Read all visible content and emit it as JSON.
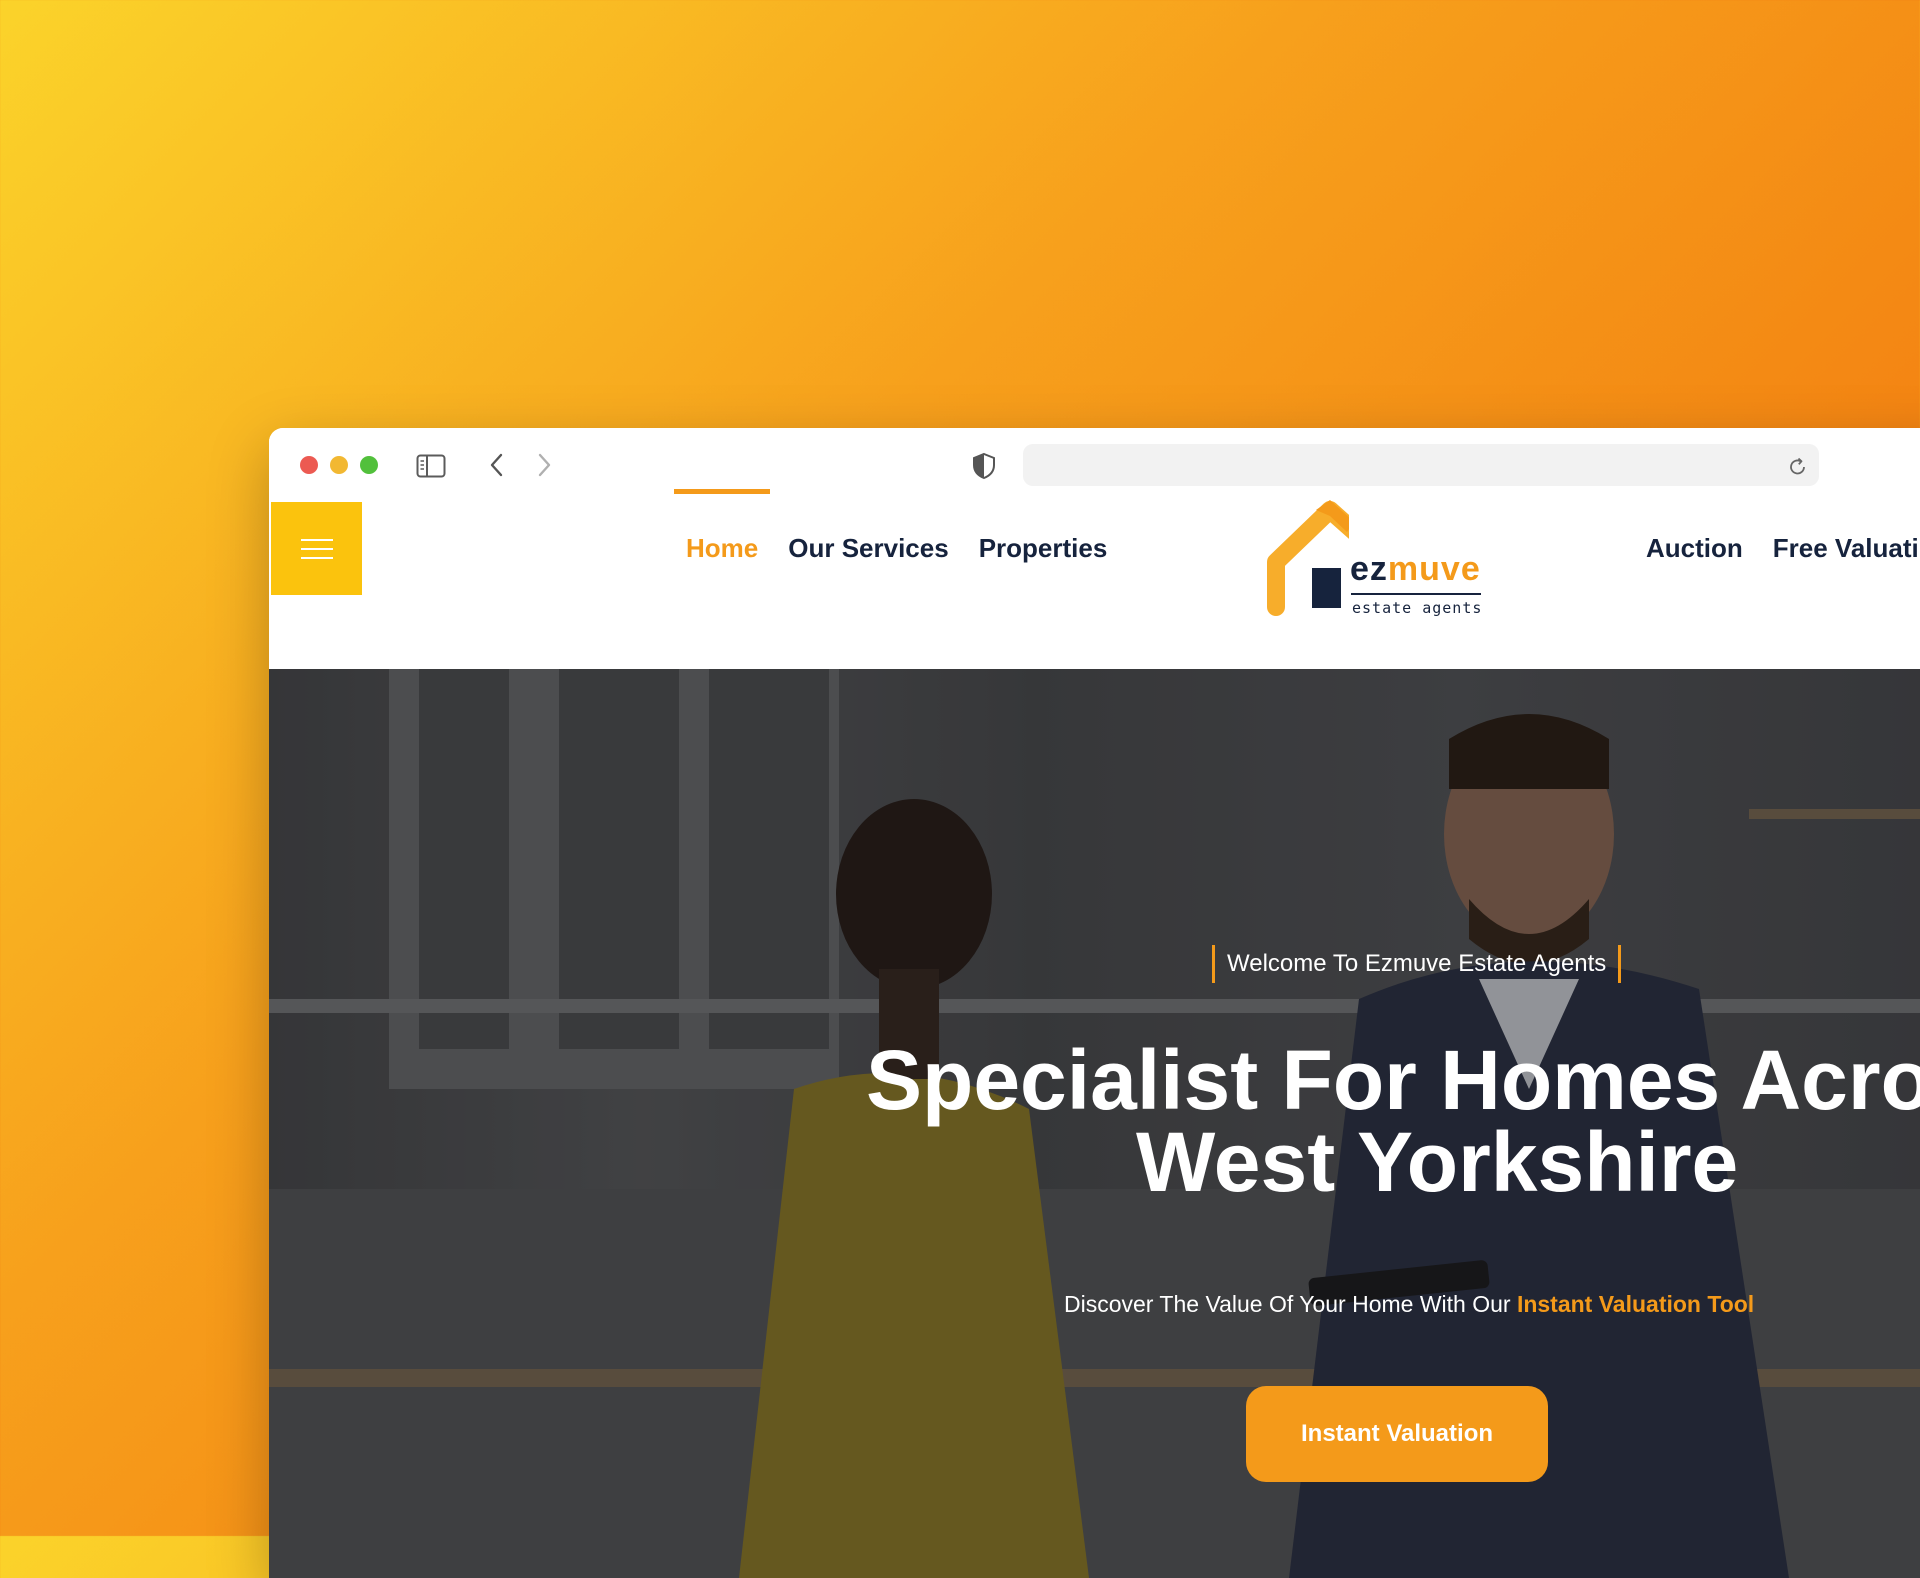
{
  "browser": {
    "address_value": ""
  },
  "header": {
    "nav_left": [
      {
        "label": "Home",
        "active": true
      },
      {
        "label": "Our Services"
      },
      {
        "label": "Properties"
      }
    ],
    "nav_right": [
      {
        "label": "Auction"
      },
      {
        "label": "Free Valuati"
      }
    ],
    "logo": {
      "brand_prefix": "ez",
      "brand_suffix": "muve",
      "tagline": "estate agents"
    }
  },
  "hero": {
    "kicker": "Welcome To Ezmuve Estate Agents",
    "headline_line1": "Specialist For Homes Across",
    "headline_line2": "West Yorkshire",
    "subtext_prefix": "Discover The Value Of Your Home With Our ",
    "subtext_highlight": "Instant Valuation Tool",
    "cta_label": "Instant Valuation"
  },
  "colors": {
    "accent": "#f49a1a",
    "navy": "#16233d",
    "hamburger_bg": "#fbc30d"
  }
}
